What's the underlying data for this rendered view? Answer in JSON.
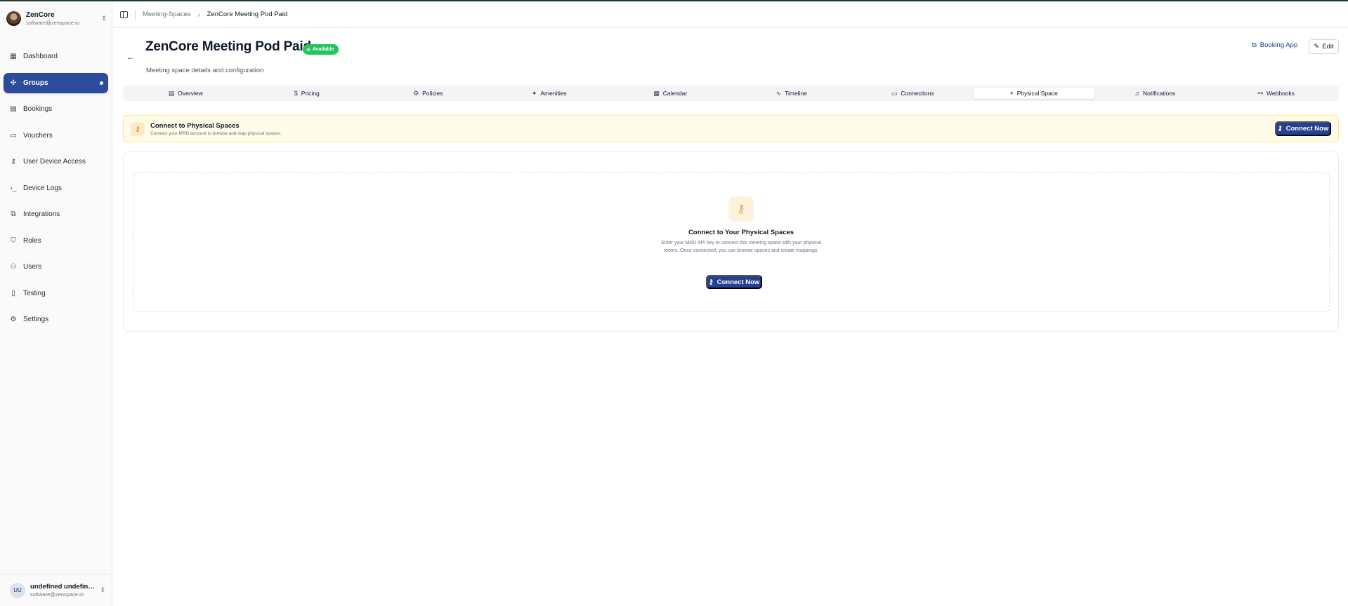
{
  "org": {
    "name": "ZenCore",
    "email": "software@zenspace.io"
  },
  "sidebar": {
    "items": [
      {
        "label": "Dashboard",
        "icon": "dashboard-icon",
        "glyph": "▦"
      },
      {
        "label": "Groups",
        "icon": "groups-icon",
        "glyph": "✣",
        "active": true
      },
      {
        "label": "Bookings",
        "icon": "calendar-icon",
        "glyph": "▤"
      },
      {
        "label": "Vouchers",
        "icon": "ticket-icon",
        "glyph": "▭"
      },
      {
        "label": "User Device Access",
        "icon": "key-icon",
        "glyph": "⚷"
      },
      {
        "label": "Device Logs",
        "icon": "terminal-icon",
        "glyph": "›_"
      },
      {
        "label": "Integrations",
        "icon": "integrations-icon",
        "glyph": "⧉"
      },
      {
        "label": "Roles",
        "icon": "shield-icon",
        "glyph": "⛉"
      },
      {
        "label": "Users",
        "icon": "users-icon",
        "glyph": "⚇"
      },
      {
        "label": "Testing",
        "icon": "test-tube-icon",
        "glyph": "▯"
      },
      {
        "label": "Settings",
        "icon": "gear-icon",
        "glyph": "⚙"
      }
    ]
  },
  "user": {
    "initials": "UU",
    "name": "undefined undefined",
    "email": "software@zenspace.io"
  },
  "breadcrumb": {
    "parent": "Meeting-Spaces",
    "current": "ZenCore Meeting Pod Paid"
  },
  "page": {
    "title": "ZenCore Meeting Pod Paid",
    "status": "Available",
    "subtitle": "Meeting space details and configuration",
    "booking_app_label": "Booking App",
    "edit_label": "Edit"
  },
  "tabs": [
    {
      "label": "Overview",
      "icon": "document-icon",
      "glyph": "▤"
    },
    {
      "label": "Pricing",
      "icon": "dollar-icon",
      "glyph": "$"
    },
    {
      "label": "Policies",
      "icon": "policy-gear-icon",
      "glyph": "⚙"
    },
    {
      "label": "Amenities",
      "icon": "sparkles-icon",
      "glyph": "✦"
    },
    {
      "label": "Calendar",
      "icon": "calendar-icon",
      "glyph": "▦"
    },
    {
      "label": "Timeline",
      "icon": "activity-icon",
      "glyph": "∿"
    },
    {
      "label": "Connections",
      "icon": "monitor-icon",
      "glyph": "▭"
    },
    {
      "label": "Physical Space",
      "icon": "map-pin-icon",
      "glyph": "⌖",
      "active": true
    },
    {
      "label": "Notifications",
      "icon": "bell-icon",
      "glyph": "♫"
    },
    {
      "label": "Webhooks",
      "icon": "webhook-icon",
      "glyph": "⚯"
    }
  ],
  "banner": {
    "title": "Connect to Physical Spaces",
    "description": "Connect your MRD account to browse and map physical spaces.",
    "button_label": "Connect Now"
  },
  "empty_state": {
    "title": "Connect to Your Physical Spaces",
    "description": "Enter your MRD API key to connect this meeting space with your physical rooms. Once connected, you can browse spaces and create mappings.",
    "button_label": "Connect Now"
  },
  "colors": {
    "primary": "#24408e",
    "active_nav": "#2d4b9b",
    "status_green": "#22c55e",
    "banner_bg": "#fefce8",
    "accent_amber": "#e0a43b"
  }
}
